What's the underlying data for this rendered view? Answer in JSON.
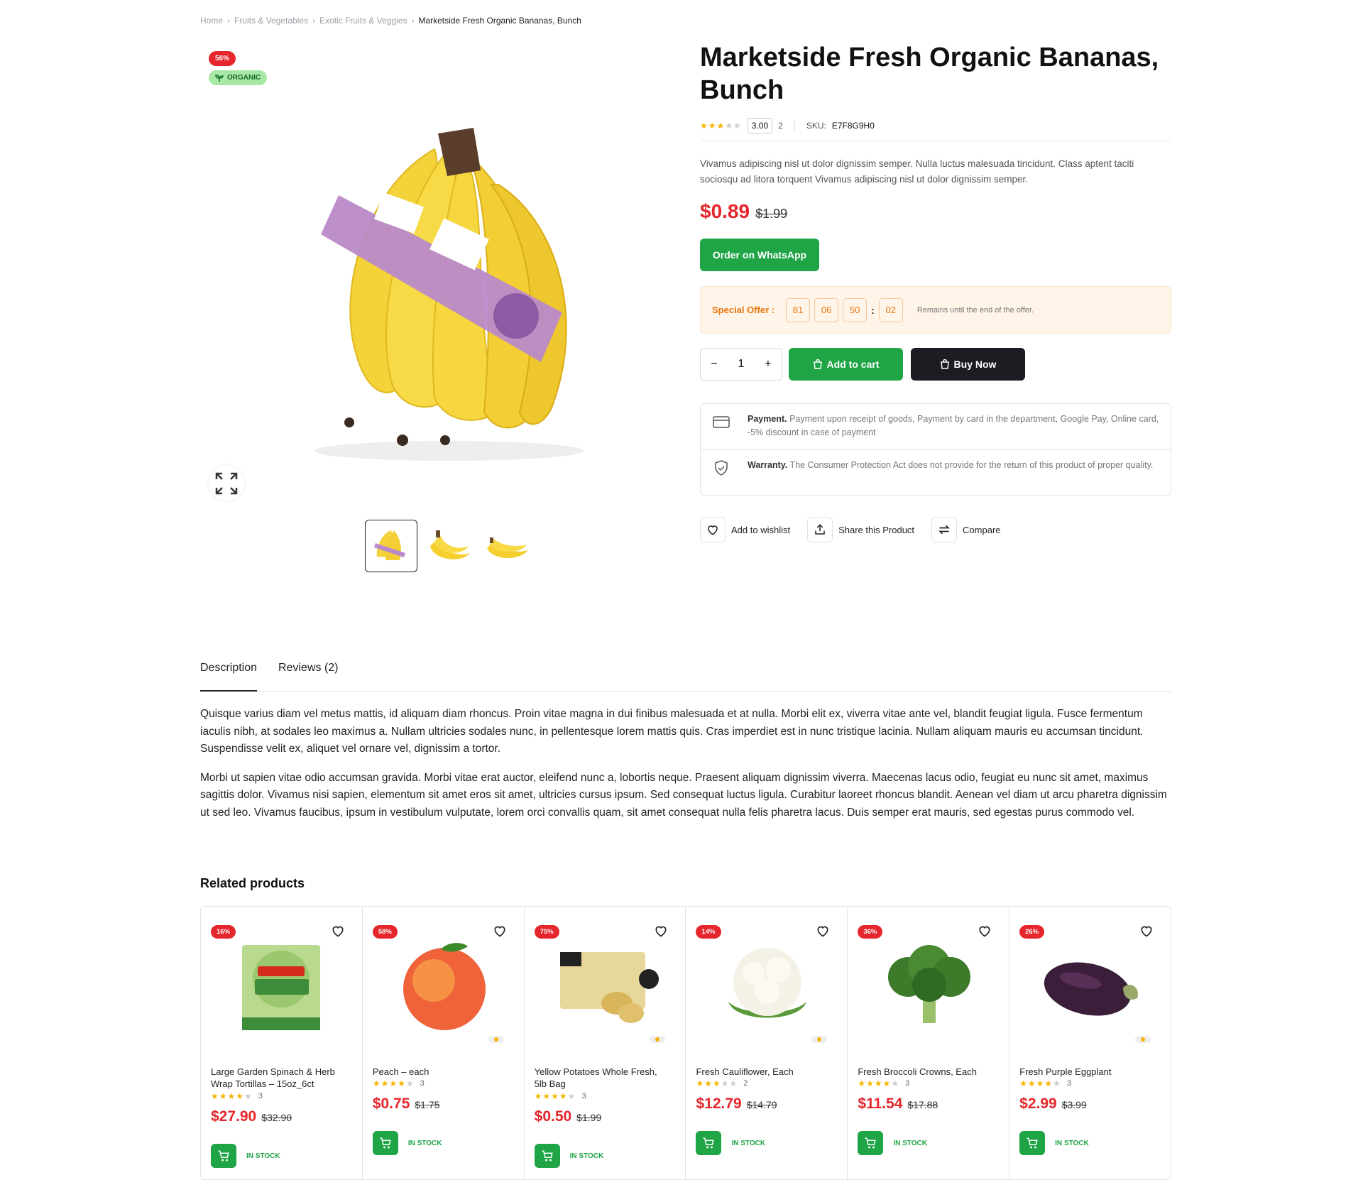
{
  "breadcrumb": [
    "Home",
    "Fruits & Vegetables",
    "Exotic Fruits & Veggies",
    "Marketside Fresh Organic Bananas, Bunch"
  ],
  "badges": {
    "discount": "56%",
    "organic": "ORGANIC"
  },
  "product": {
    "title": "Marketside Fresh Organic Bananas, Bunch",
    "rating": "3.00",
    "review_count": "2",
    "sku_label": "SKU:",
    "sku": "E7F8G9H0",
    "short_description": "Vivamus adipiscing nisl ut dolor dignissim semper. Nulla luctus malesuada tincidunt. Class aptent taciti sociosqu ad litora torquent Vivamus adipiscing nisl ut dolor dignissim semper.",
    "price": "$0.89",
    "old_price": "$1.99",
    "whatsapp": "Order on WhatsApp"
  },
  "offer": {
    "label": "Special Offer :",
    "days": "81",
    "hours": "06",
    "minutes": "50",
    "seconds": "02",
    "remains": "Remains until the end of the offer."
  },
  "purchase": {
    "qty": "1",
    "minus": "−",
    "plus": "+",
    "add_to_cart": "Add to cart",
    "buy_now": "Buy Now"
  },
  "info": {
    "payment_title": "Payment.",
    "payment_text": "Payment upon receipt of goods, Payment by card in the department, Google Pay, Online card, -5% discount in case of payment",
    "warranty_title": "Warranty.",
    "warranty_text": "The Consumer Protection Act does not provide for the return of this product of proper quality."
  },
  "actions": {
    "wishlist": "Add to wishlist",
    "share": "Share this Product",
    "compare": "Compare"
  },
  "tabs": [
    "Description",
    "Reviews (2)"
  ],
  "description": [
    "Quisque varius diam vel metus mattis, id aliquam diam rhoncus. Proin vitae magna in dui finibus malesuada et at nulla. Morbi elit ex, viverra vitae ante vel, blandit feugiat ligula. Fusce fermentum iaculis nibh, at sodales leo maximus a. Nullam ultricies sodales nunc, in pellentesque lorem mattis quis. Cras imperdiet est in nunc tristique lacinia. Nullam aliquam mauris eu accumsan tincidunt. Suspendisse velit ex, aliquet vel ornare vel, dignissim a tortor.",
    "Morbi ut sapien vitae odio accumsan gravida. Morbi vitae erat auctor, eleifend nunc a, lobortis neque. Praesent aliquam dignissim viverra. Maecenas lacus odio, feugiat eu nunc sit amet, maximus sagittis dolor. Vivamus nisi sapien, elementum sit amet eros sit amet, ultricies cursus ipsum. Sed consequat luctus ligula. Curabitur laoreet rhoncus blandit. Aenean vel diam ut arcu pharetra dignissim ut sed leo. Vivamus faucibus, ipsum in vestibulum vulputate, lorem orci convallis quam, sit amet consequat nulla felis pharetra lacus. Duis semper erat mauris, sed egestas purus commodo vel."
  ],
  "related_title": "Related products",
  "related": [
    {
      "discount": "16%",
      "name": "Large Garden Spinach & Herb Wrap Tortillas – 15oz_6ct",
      "reviews": "3",
      "price": "$27.90",
      "old": "$32.90",
      "stock": "IN STOCK"
    },
    {
      "discount": "58%",
      "name": "Peach – each",
      "reviews": "3",
      "price": "$0.75",
      "old": "$1.75",
      "stock": "IN STOCK"
    },
    {
      "discount": "75%",
      "name": "Yellow Potatoes Whole Fresh, 5lb Bag",
      "reviews": "3",
      "price": "$0.50",
      "old": "$1.99",
      "stock": "IN STOCK"
    },
    {
      "discount": "14%",
      "name": "Fresh Cauliflower, Each",
      "reviews": "2",
      "price": "$12.79",
      "old": "$14.79",
      "stock": "IN STOCK"
    },
    {
      "discount": "36%",
      "name": "Fresh Broccoli Crowns, Each",
      "reviews": "3",
      "price": "$11.54",
      "old": "$17.88",
      "stock": "IN STOCK"
    },
    {
      "discount": "26%",
      "name": "Fresh Purple Eggplant",
      "reviews": "3",
      "price": "$2.99",
      "old": "$3.99",
      "stock": "IN STOCK"
    }
  ],
  "colors": {
    "accent_green": "#1fa446",
    "sale_red": "#e5262c",
    "offer_orange": "#e8740c",
    "dark": "#1b1d22",
    "star": "#f5b400"
  }
}
